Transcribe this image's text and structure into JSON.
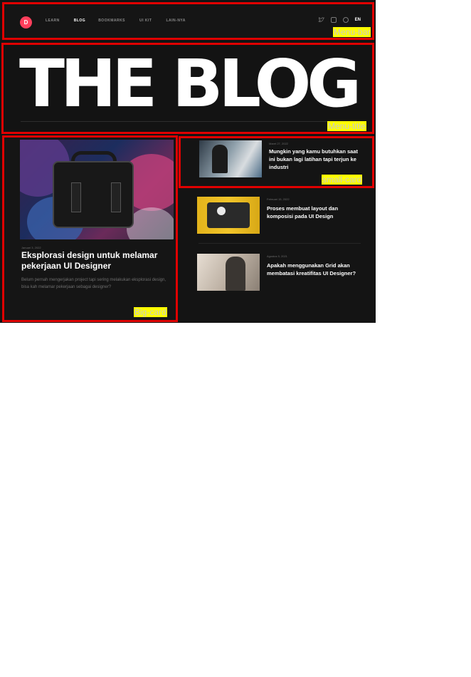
{
  "menu_bar": {
    "logo": "D",
    "nav_items": [
      "LEARN",
      "BLOG",
      "BOOKMARKS",
      "UI KIT",
      "LAIN-NYA"
    ],
    "language": "EN",
    "icons": [
      "twitter-icon",
      "instagram-icon",
      "dribbble-icon"
    ]
  },
  "title": {
    "text": "THE BLOG"
  },
  "big_card": {
    "date": "Januari 3, 2022",
    "title": "Eksplorasi design untuk melamar pekerjaan UI Designer",
    "description": "Belum pernah mengerjakan project tapi sering melakukan eksplorasi design, bisa kah melamar pekerjaan sebagai designer?"
  },
  "small_cards": [
    {
      "date": "Maret 27, 2022",
      "title": "Mungkin yang kamu butuhkan saat ini bukan lagi latihan tapi terjun ke industri"
    },
    {
      "date": "Februari 15, 2022",
      "title": "Proses membuat layout dan komposisi pada UI Design"
    },
    {
      "date": "Agustus 5, 2021",
      "title": "Apakah menggunakan Grid akan membatasi kreatifitas UI Designer?"
    }
  ],
  "annotations": {
    "menu_bar": "Menu-bar",
    "menu_title": "Menu-title",
    "small_card": "small-card",
    "big_card": "Big-card"
  },
  "colors": {
    "background": "#141414",
    "accent": "#ff3f5c",
    "annotation_border": "#e00000",
    "annotation_label": "#ffff00"
  }
}
